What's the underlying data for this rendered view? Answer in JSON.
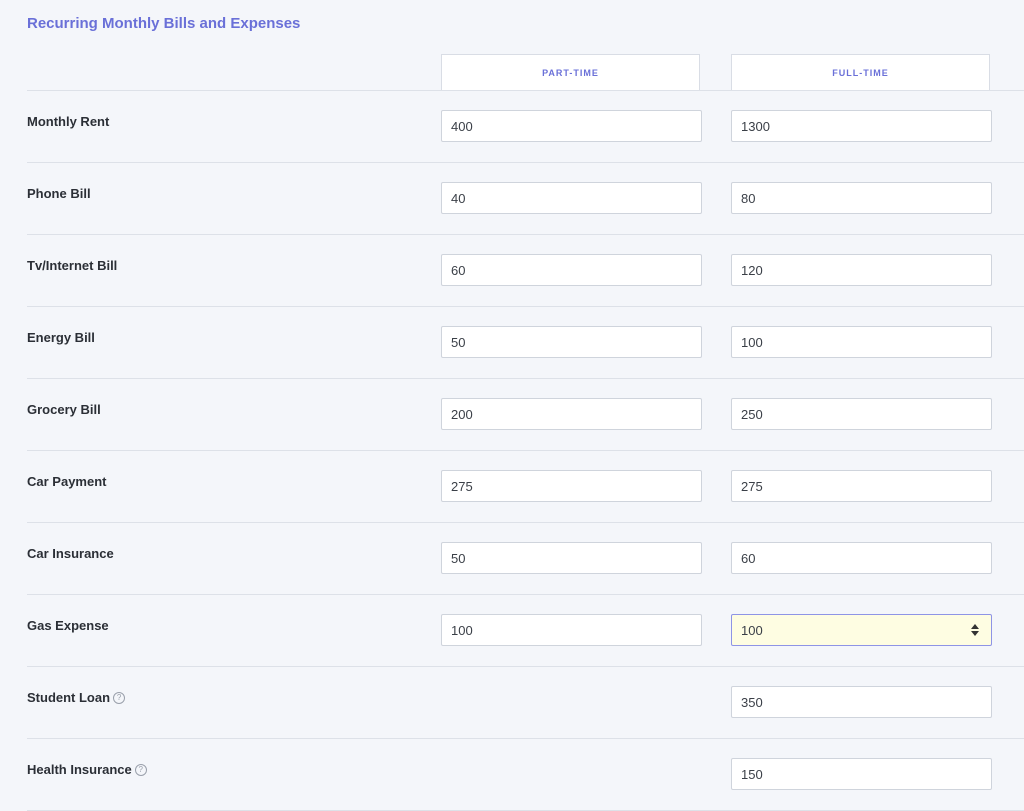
{
  "section": {
    "title": "Recurring Monthly Bills and Expenses"
  },
  "columns": {
    "part_time": "PART-TIME",
    "full_time": "FULL-TIME"
  },
  "rows": [
    {
      "label": "Monthly Rent",
      "part_time": "400",
      "full_time": "1300",
      "help": false
    },
    {
      "label": "Phone Bill",
      "part_time": "40",
      "full_time": "80",
      "help": false
    },
    {
      "label": "Tv/Internet Bill",
      "part_time": "60",
      "full_time": "120",
      "help": false
    },
    {
      "label": "Energy Bill",
      "part_time": "50",
      "full_time": "100",
      "help": false
    },
    {
      "label": "Grocery Bill",
      "part_time": "200",
      "full_time": "250",
      "help": false
    },
    {
      "label": "Car Payment",
      "part_time": "275",
      "full_time": "275",
      "help": false
    },
    {
      "label": "Car Insurance",
      "part_time": "50",
      "full_time": "60",
      "help": false
    },
    {
      "label": "Gas Expense",
      "part_time": "100",
      "full_time": "100",
      "help": false,
      "active": "full_time"
    },
    {
      "label": "Student Loan",
      "part_time": null,
      "full_time": "350",
      "help": true
    },
    {
      "label": "Health Insurance",
      "part_time": null,
      "full_time": "150",
      "help": true
    }
  ],
  "icons": {
    "help": "question-circle-icon",
    "spinner": "number-spinner-icon"
  },
  "colors": {
    "accent": "#6a70d8",
    "active_field_bg": "#fefde2",
    "page_bg": "#f4f6fa"
  }
}
